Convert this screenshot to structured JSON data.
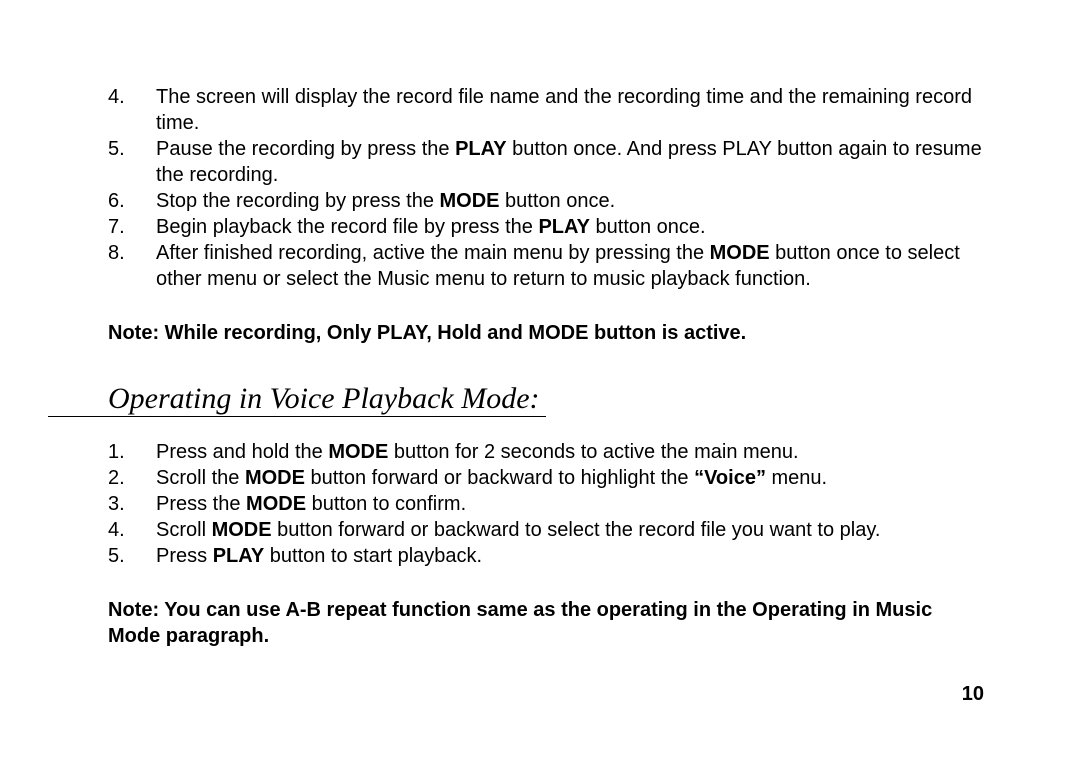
{
  "list1": [
    {
      "num": "4.",
      "segments": [
        {
          "t": "The screen will display the record file name and the recording time and the remaining record time.",
          "b": false
        }
      ]
    },
    {
      "num": "5.",
      "segments": [
        {
          "t": "Pause the recording by press the ",
          "b": false
        },
        {
          "t": "PLAY",
          "b": true
        },
        {
          "t": " button once. And press PLAY button again to resume the recording.",
          "b": false
        }
      ]
    },
    {
      "num": "6.",
      "segments": [
        {
          "t": "Stop the recording by press the ",
          "b": false
        },
        {
          "t": "MODE",
          "b": true
        },
        {
          "t": " button once.",
          "b": false
        }
      ]
    },
    {
      "num": "7.",
      "segments": [
        {
          "t": "Begin playback the record file by press the ",
          "b": false
        },
        {
          "t": "PLAY",
          "b": true
        },
        {
          "t": " button once.",
          "b": false
        }
      ]
    },
    {
      "num": "8.",
      "segments": [
        {
          "t": "After finished recording, active the main menu by pressing the ",
          "b": false
        },
        {
          "t": "MODE",
          "b": true
        },
        {
          "t": " button once to select other menu or select the Music menu to return to music playback function.",
          "b": false
        }
      ]
    }
  ],
  "note1": "Note: While recording, Only PLAY, Hold and MODE button is active.",
  "heading": "Operating in Voice Playback Mode:",
  "list2": [
    {
      "num": "1.",
      "segments": [
        {
          "t": "Press and hold the ",
          "b": false
        },
        {
          "t": "MODE",
          "b": true
        },
        {
          "t": " button for 2 seconds to active the main menu.",
          "b": false
        }
      ]
    },
    {
      "num": "2.",
      "segments": [
        {
          "t": "Scroll the ",
          "b": false
        },
        {
          "t": "MODE",
          "b": true
        },
        {
          "t": " button forward or backward to highlight the ",
          "b": false
        },
        {
          "t": "“Voice”",
          "b": true
        },
        {
          "t": " menu.",
          "b": false
        }
      ]
    },
    {
      "num": "3.",
      "segments": [
        {
          "t": "Press the ",
          "b": false
        },
        {
          "t": "MODE",
          "b": true
        },
        {
          "t": " button to confirm.",
          "b": false
        }
      ]
    },
    {
      "num": "4.",
      "segments": [
        {
          "t": "Scroll ",
          "b": false
        },
        {
          "t": "MODE",
          "b": true
        },
        {
          "t": " button forward or backward to select the record file you want to play.",
          "b": false
        }
      ]
    },
    {
      "num": "5.",
      "segments": [
        {
          "t": "Press ",
          "b": false
        },
        {
          "t": "PLAY",
          "b": true
        },
        {
          "t": " button to start playback.",
          "b": false
        }
      ]
    }
  ],
  "note2": "Note: You can use A-B repeat function same as the operating in the Operating in Music Mode paragraph.",
  "page_number": "10"
}
